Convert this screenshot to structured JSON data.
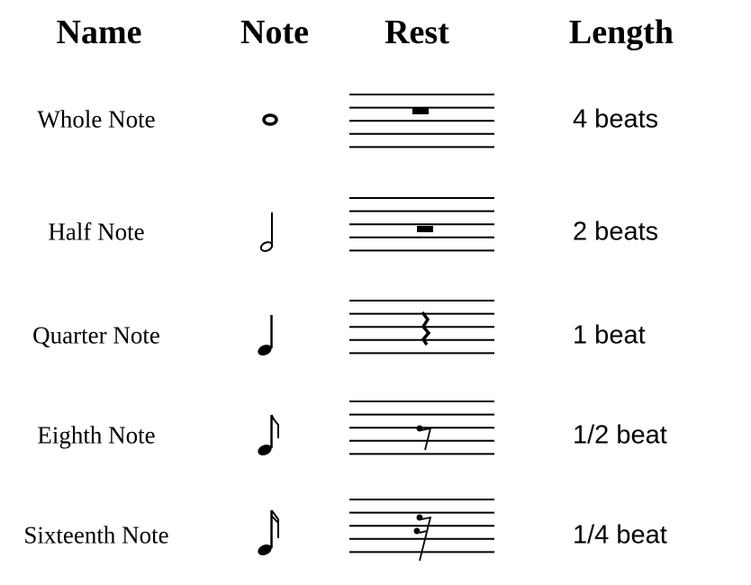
{
  "headers": {
    "name": "Name",
    "note": "Note",
    "rest": "Rest",
    "length": "Length"
  },
  "rows": [
    {
      "name": "Whole Note",
      "note_icon": "whole-note-icon",
      "rest_icon": "whole-rest-icon",
      "length": "4 beats"
    },
    {
      "name": "Half Note",
      "note_icon": "half-note-icon",
      "rest_icon": "half-rest-icon",
      "length": "2 beats"
    },
    {
      "name": "Quarter Note",
      "note_icon": "quarter-note-icon",
      "rest_icon": "quarter-rest-icon",
      "length": "1 beat"
    },
    {
      "name": "Eighth Note",
      "note_icon": "eighth-note-icon",
      "rest_icon": "eighth-rest-icon",
      "length": "1/2 beat"
    },
    {
      "name": "Sixteenth Note",
      "note_icon": "sixteenth-note-icon",
      "rest_icon": "sixteenth-rest-icon",
      "length": "1/4 beat"
    }
  ]
}
